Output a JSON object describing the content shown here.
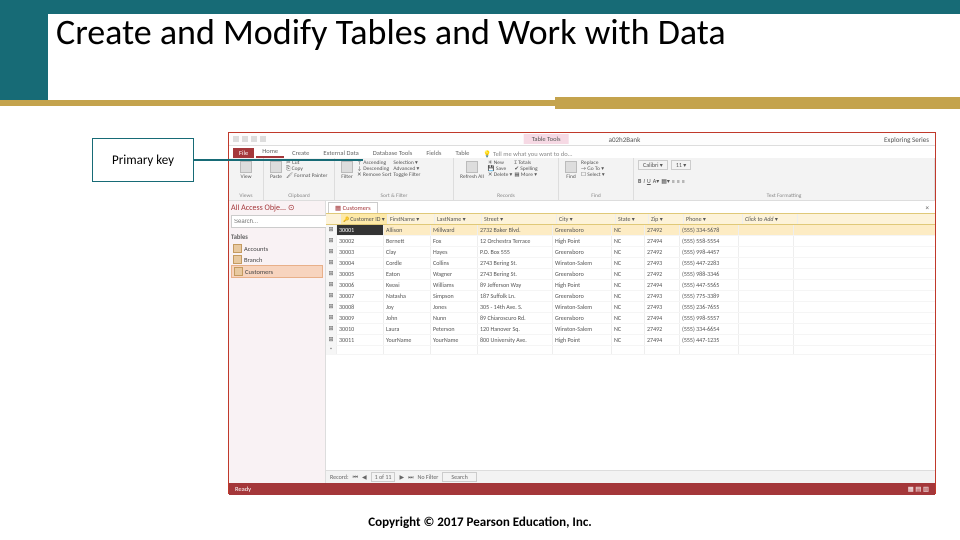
{
  "slide": {
    "title": "Create and Modify Tables and Work with Data",
    "callout": "Primary key",
    "copyright": "Copyright © 2017 Pearson Education, Inc."
  },
  "app": {
    "filename": "a02h2Bank",
    "table_tools": "Table Tools",
    "signin": "Exploring Series",
    "tabs": {
      "file": "File",
      "home": "Home",
      "create": "Create",
      "external": "External Data",
      "dbtools": "Database Tools",
      "fields": "Fields",
      "table": "Table",
      "tellme": "Tell me what you want to do..."
    },
    "ribbon": {
      "views": {
        "label": "Views",
        "view": "View"
      },
      "clipboard": {
        "label": "Clipboard",
        "paste": "Paste",
        "cut": "Cut",
        "copy": "Copy",
        "fmt": "Format Painter"
      },
      "sortfilter": {
        "label": "Sort & Filter",
        "filter": "Filter",
        "asc": "Ascending",
        "desc": "Descending",
        "rem": "Remove Sort",
        "sel": "Selection",
        "adv": "Advanced",
        "tog": "Toggle Filter"
      },
      "records": {
        "label": "Records",
        "refresh": "Refresh All",
        "new": "New",
        "save": "Save",
        "delete": "Delete",
        "totals": "Totals",
        "spell": "Spelling",
        "more": "More"
      },
      "find": {
        "label": "Find",
        "find": "Find",
        "replace": "Replace",
        "goto": "Go To",
        "select": "Select"
      },
      "textfmt": {
        "label": "Text Formatting",
        "font": "Calibri",
        "size": "11"
      }
    },
    "nav": {
      "header": "All Access Obje...",
      "search_ph": "Search...",
      "tables_cat": "Tables",
      "items": [
        "Accounts",
        "Branch",
        "Customers"
      ]
    },
    "datasheet": {
      "tab": "Customers",
      "columns": [
        "Customer ID",
        "FirstName",
        "LastName",
        "Street",
        "City",
        "State",
        "Zip",
        "Phone",
        "Click to Add"
      ],
      "rows": [
        {
          "id": "30001",
          "fn": "Allison",
          "ln": "Millward",
          "st": "2732 Baker Blvd.",
          "city": "Greensboro",
          "state": "NC",
          "zip": "27492",
          "ph": "(555) 334-5678"
        },
        {
          "id": "30002",
          "fn": "Bernett",
          "ln": "Fox",
          "st": "12 Orchestra Terrace",
          "city": "High Point",
          "state": "NC",
          "zip": "27494",
          "ph": "(555) 558-5554"
        },
        {
          "id": "30003",
          "fn": "Clay",
          "ln": "Hayes",
          "st": "P.O. Box 555",
          "city": "Greensboro",
          "state": "NC",
          "zip": "27492",
          "ph": "(555) 998-4457"
        },
        {
          "id": "30004",
          "fn": "Cordle",
          "ln": "Collins",
          "st": "2743 Bering St.",
          "city": "Winston-Salem",
          "state": "NC",
          "zip": "27493",
          "ph": "(555) 447-2283"
        },
        {
          "id": "30005",
          "fn": "Eaton",
          "ln": "Wagner",
          "st": "2743 Bering St.",
          "city": "Greensboro",
          "state": "NC",
          "zip": "27492",
          "ph": "(555) 988-3346"
        },
        {
          "id": "30006",
          "fn": "Kwasi",
          "ln": "Williams",
          "st": "89 Jefferson Way",
          "city": "High Point",
          "state": "NC",
          "zip": "27494",
          "ph": "(555) 447-5565"
        },
        {
          "id": "30007",
          "fn": "Natasha",
          "ln": "Simpson",
          "st": "187 Suffolk Ln.",
          "city": "Greensboro",
          "state": "NC",
          "zip": "27493",
          "ph": "(555) 775-3389"
        },
        {
          "id": "30008",
          "fn": "Joy",
          "ln": "Jones",
          "st": "305 - 14th Ave. S.",
          "city": "Winston-Salem",
          "state": "NC",
          "zip": "27493",
          "ph": "(555) 236-7655"
        },
        {
          "id": "30009",
          "fn": "John",
          "ln": "Nunn",
          "st": "89 Chiaroscuro Rd.",
          "city": "Greensboro",
          "state": "NC",
          "zip": "27494",
          "ph": "(555) 998-5557"
        },
        {
          "id": "30010",
          "fn": "Laura",
          "ln": "Peterson",
          "st": "120 Hanover Sq.",
          "city": "Winston-Salem",
          "state": "NC",
          "zip": "27492",
          "ph": "(555) 334-6654"
        },
        {
          "id": "30011",
          "fn": "YourName",
          "ln": "YourName",
          "st": "800 University Ave.",
          "city": "High Point",
          "state": "NC",
          "zip": "27494",
          "ph": "(555) 447-1235"
        }
      ],
      "recnav": {
        "label": "Record:",
        "pos": "1 of 11",
        "nofilter": "No Filter",
        "search": "Search"
      }
    },
    "status": "Ready"
  }
}
